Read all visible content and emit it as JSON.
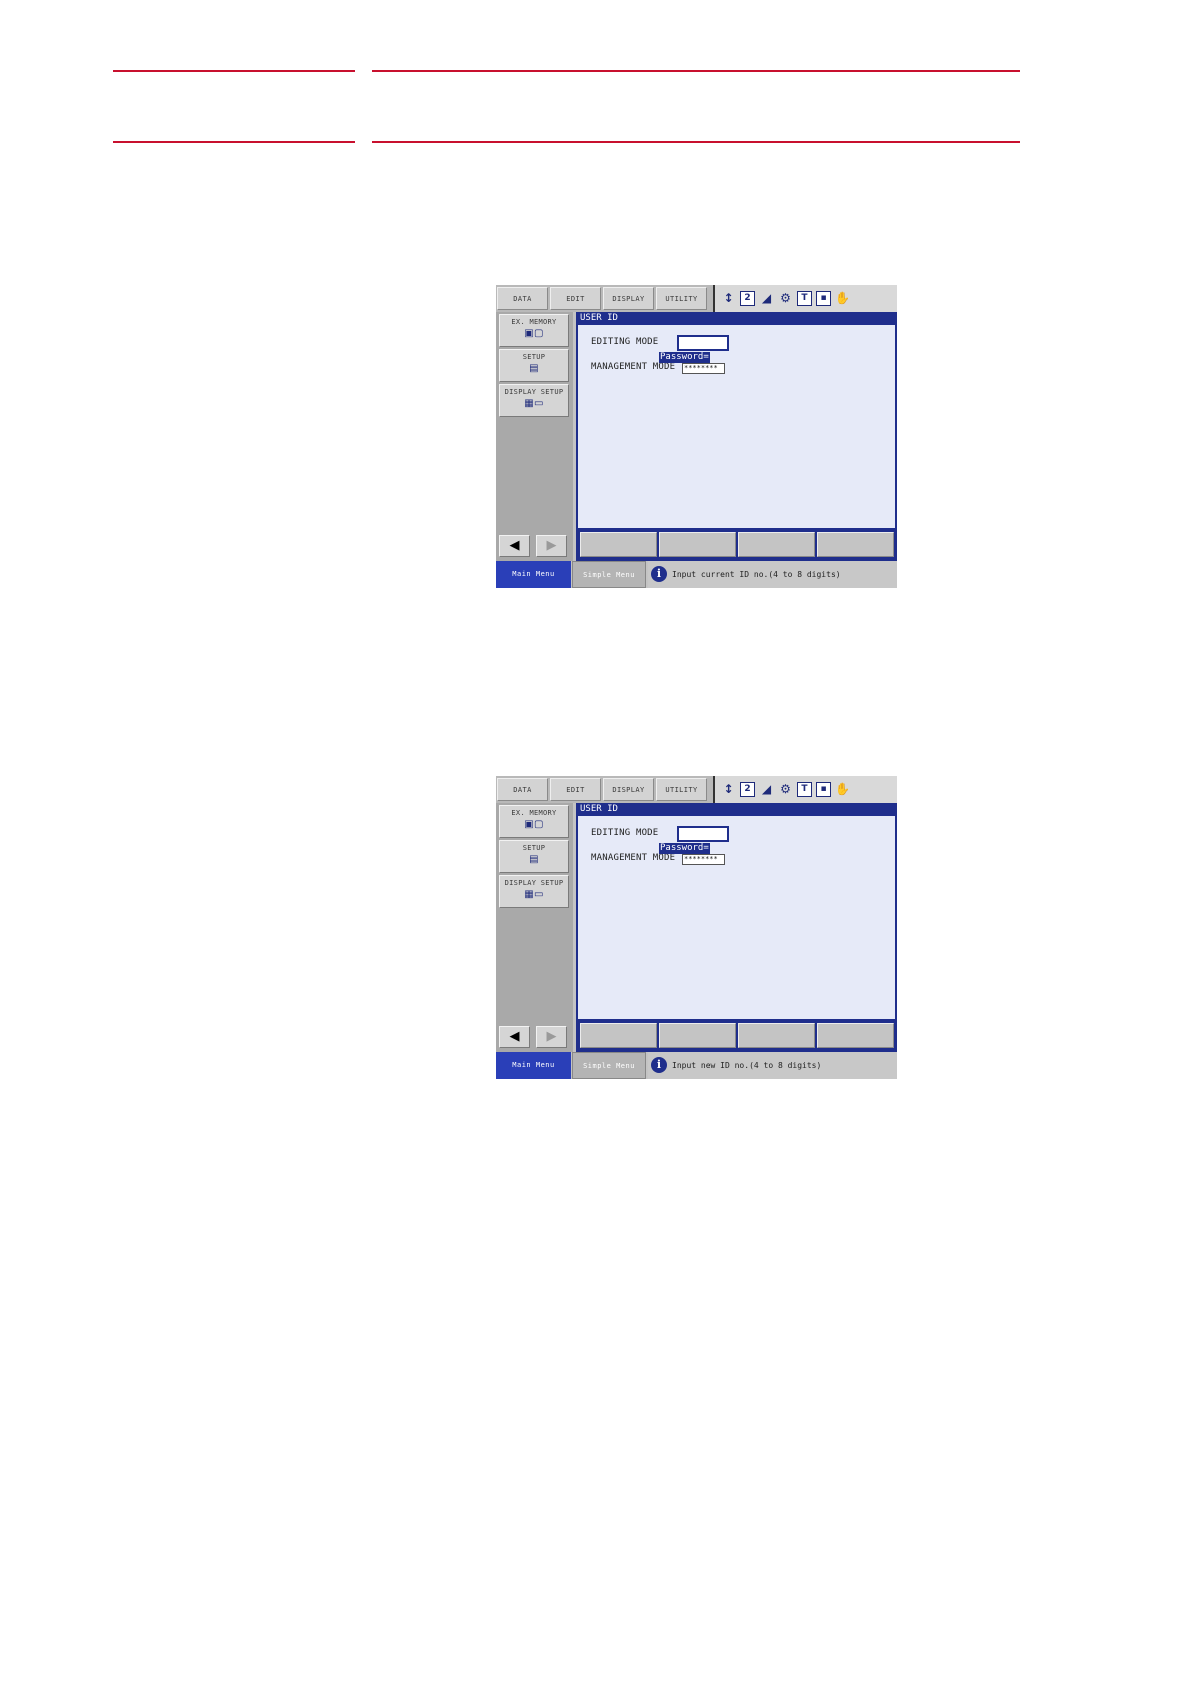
{
  "colors": {
    "rule": "#c8102e",
    "accent": "#1f2e8c",
    "screen_bg": "#e6eaf8"
  },
  "screens": [
    {
      "tabs": [
        "DATA",
        "EDIT",
        "DISPLAY",
        "UTILITY"
      ],
      "menu_buttons": [
        {
          "label": "EX. MEMORY",
          "icon": "floppy-disk-icon"
        },
        {
          "label": "SETUP",
          "icon": "setup-icon"
        },
        {
          "label": "DISPLAY SETUP",
          "icon": "display-setup-icon"
        }
      ],
      "window_title": "USER ID",
      "editing_mode_label": "EDITING MODE",
      "password_label": "Password=",
      "management_mode_label": "MANAGEMENT MODE",
      "password_value": "********",
      "main_menu": "Main Menu",
      "simple_menu": "Simple Menu",
      "message": "Input current ID no.(4 to 8 digits)"
    },
    {
      "tabs": [
        "DATA",
        "EDIT",
        "DISPLAY",
        "UTILITY"
      ],
      "menu_buttons": [
        {
          "label": "EX. MEMORY",
          "icon": "floppy-disk-icon"
        },
        {
          "label": "SETUP",
          "icon": "setup-icon"
        },
        {
          "label": "DISPLAY SETUP",
          "icon": "display-setup-icon"
        }
      ],
      "window_title": "USER ID",
      "editing_mode_label": "EDITING MODE",
      "password_label": "Password=",
      "management_mode_label": "MANAGEMENT MODE",
      "password_value": "********",
      "main_menu": "Main Menu",
      "simple_menu": "Simple Menu",
      "message": "Input new ID no.(4 to 8 digits)"
    }
  ]
}
